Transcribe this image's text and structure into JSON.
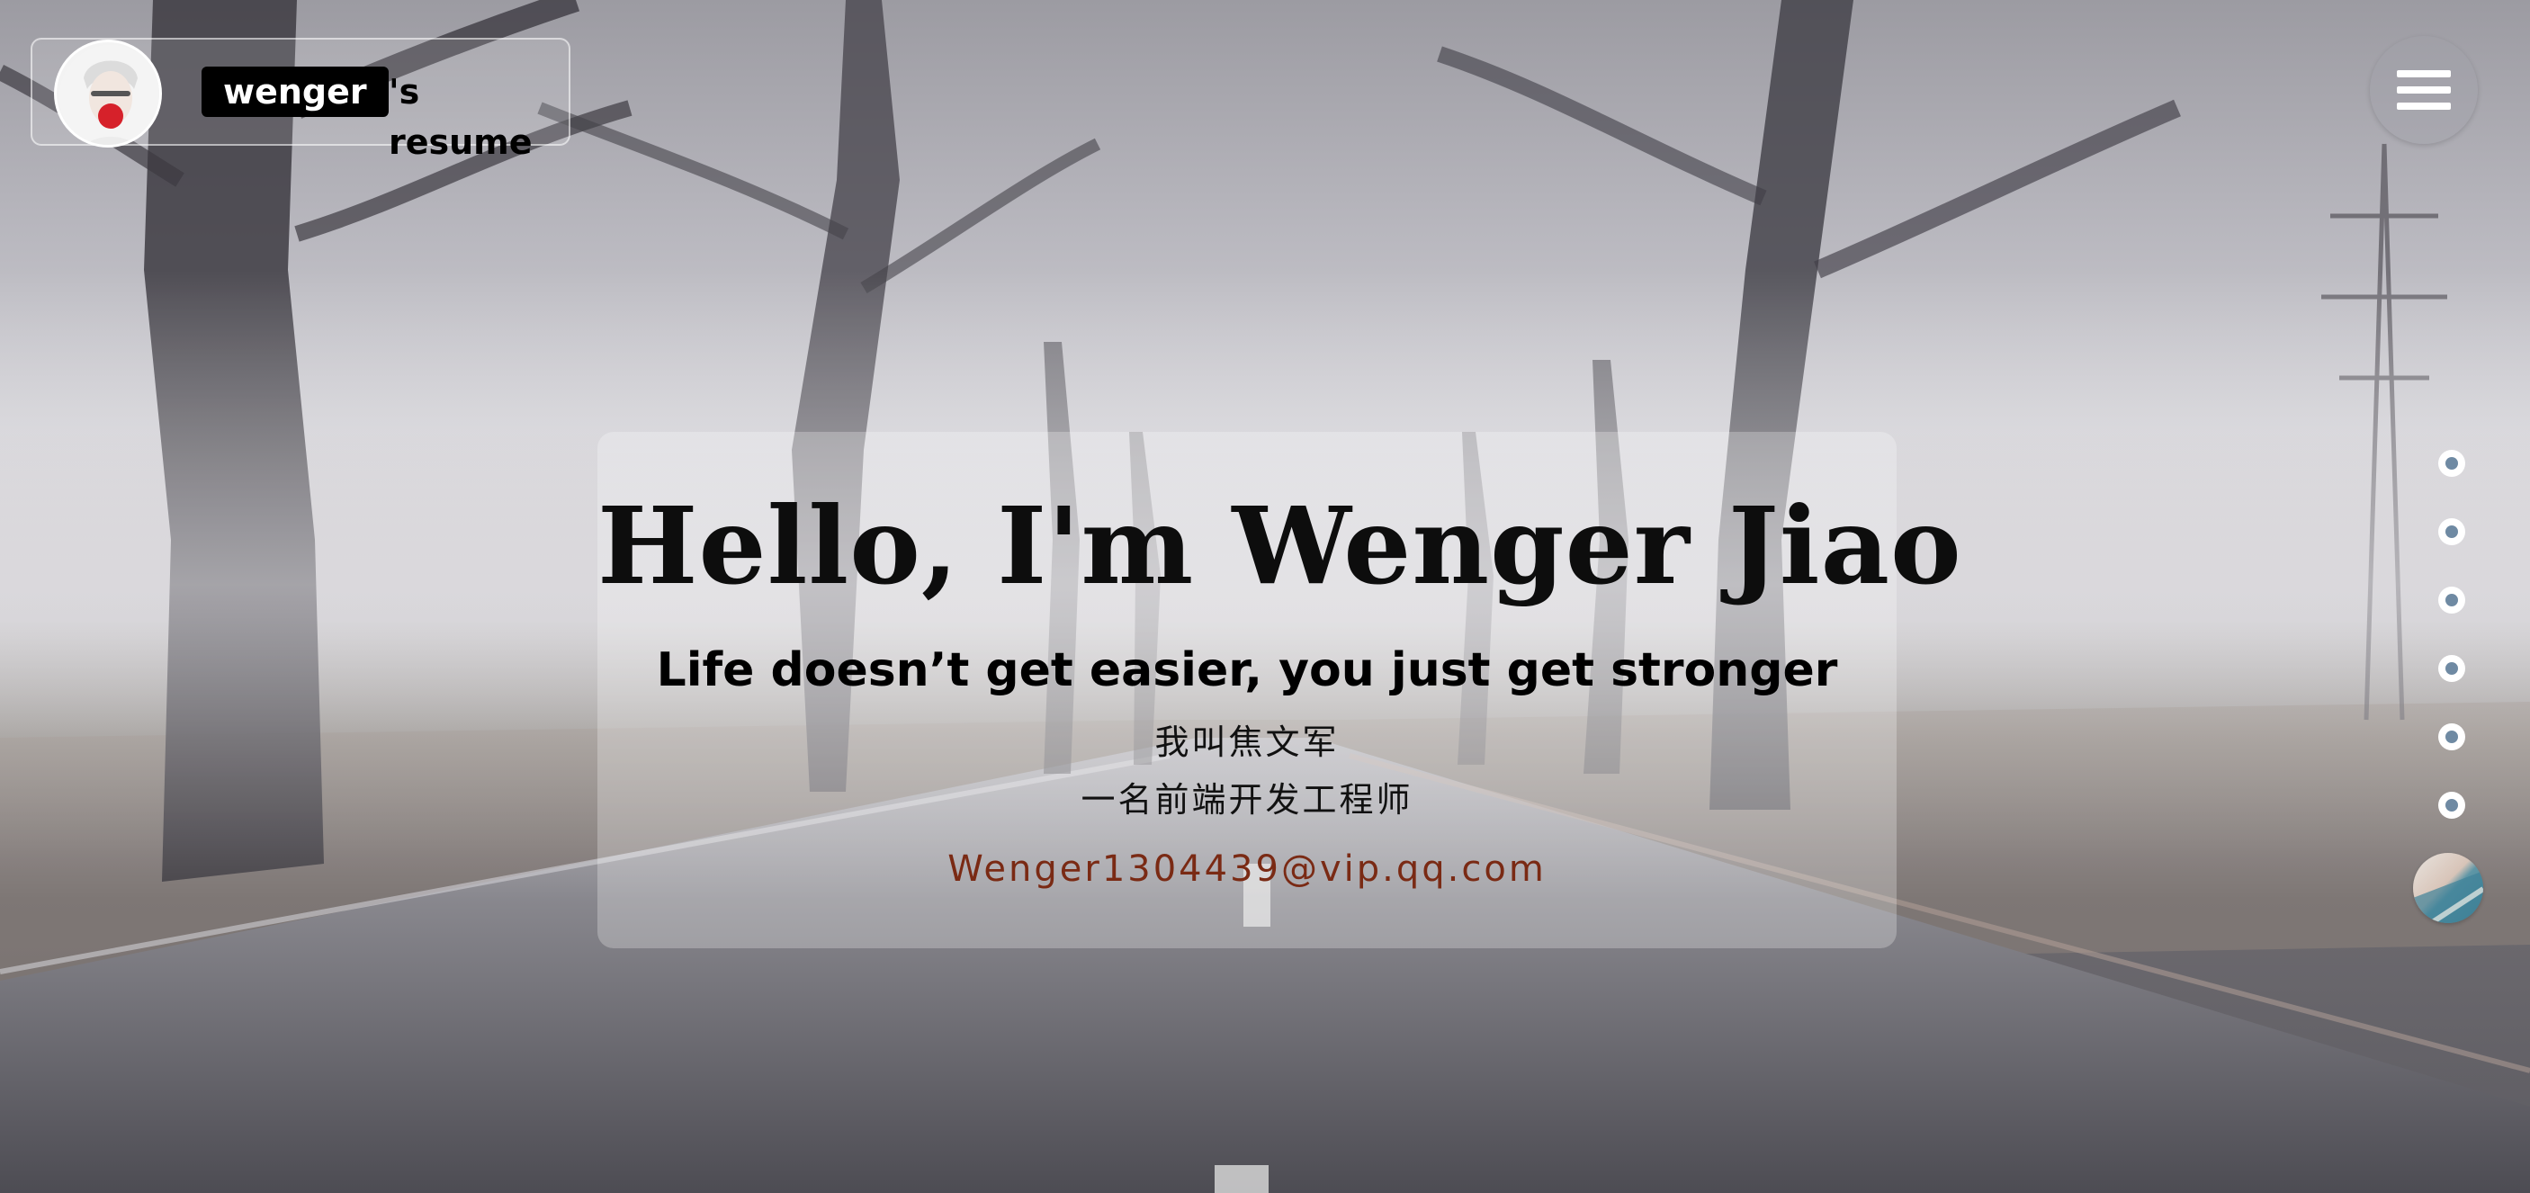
{
  "brand": {
    "name": "wenger",
    "suffix": "'s resume"
  },
  "hero": {
    "title": "Hello, I'm Wenger Jiao",
    "subtitle": "Life doesn’t get easier, you just get stronger",
    "name_cn": "我叫焦文军",
    "role_cn": "一名前端开发工程师",
    "email": "Wenger1304439@vip.qq.com"
  },
  "nav": {
    "menu_icon": "hamburger-menu-icon",
    "section_dot_count": 6,
    "music_icon": "music-disc-icon"
  },
  "colors": {
    "email": "#7a2a14",
    "dot_inner": "#6f8aa3",
    "brand_bg": "#000000"
  }
}
